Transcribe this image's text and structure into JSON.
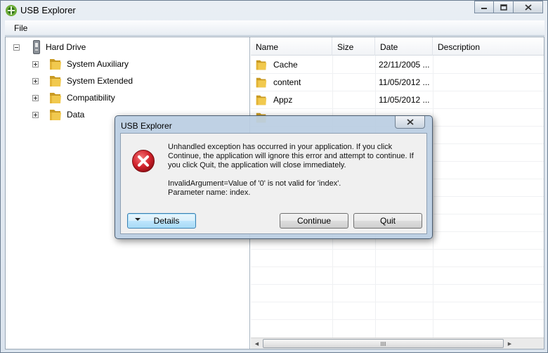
{
  "window": {
    "title": "USB Explorer"
  },
  "menu": {
    "file": "File"
  },
  "tree": {
    "root": "Hard Drive",
    "children": [
      "System Auxiliary",
      "System Extended",
      "Compatibility",
      "Data"
    ]
  },
  "list": {
    "columns": [
      "Name",
      "Size",
      "Date",
      "Description"
    ],
    "rows": [
      {
        "name": "Cache",
        "date": "22/11/2005 ..."
      },
      {
        "name": "content",
        "date": "11/05/2012 ..."
      },
      {
        "name": "Appz",
        "date": "11/05/2012 ..."
      }
    ]
  },
  "dialog": {
    "title": "USB Explorer",
    "message": "Unhandled exception has occurred in your application. If you click Continue, the application will ignore this error and attempt to continue. If you click Quit, the application will close immediately.",
    "detail_line1": "InvalidArgument=Value of '0' is not valid for 'index'.",
    "detail_line2": "Parameter name: index.",
    "details_button": "Details",
    "continue_button": "Continue",
    "quit_button": "Quit"
  },
  "icons": {
    "app": "usb-app-icon",
    "minimize": "minimize-icon",
    "maximize": "maximize-icon",
    "close": "close-icon",
    "drive": "usb-drive-icon",
    "folder": "folder-icon",
    "error": "error-icon"
  },
  "colors": {
    "folder": "#e8b93a",
    "error": "#d1212b",
    "accent": "#3c7fb1"
  }
}
